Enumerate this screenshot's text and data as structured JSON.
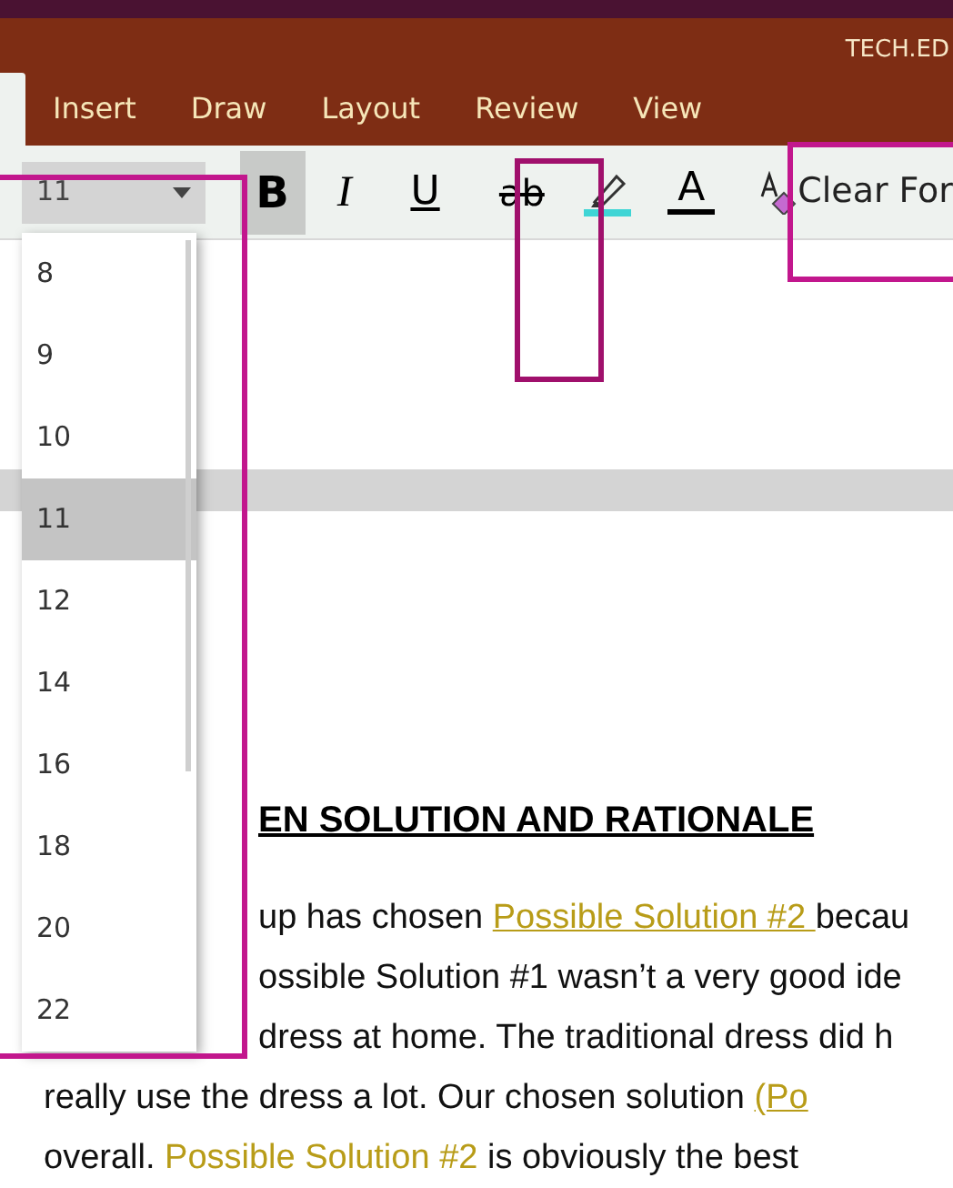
{
  "title_bar": {
    "title": "TECH.ED"
  },
  "tabs": [
    {
      "label": "Insert",
      "selected": false
    },
    {
      "label": "Draw",
      "selected": false
    },
    {
      "label": "Layout",
      "selected": false
    },
    {
      "label": "Review",
      "selected": false
    },
    {
      "label": "View",
      "selected": false
    }
  ],
  "toolbar": {
    "font_size": "11",
    "buttons": [
      {
        "kind": "bold",
        "label": "B",
        "pressed": true
      },
      {
        "kind": "italic",
        "label": "I",
        "pressed": false
      },
      {
        "kind": "underline",
        "label": "U",
        "pressed": false
      },
      {
        "kind": "strikethrough",
        "label": "ab",
        "pressed": false
      },
      {
        "kind": "highlight",
        "pressed": false
      },
      {
        "kind": "font_color",
        "label": "A",
        "pressed": false
      },
      {
        "kind": "clear",
        "label": "Clear For",
        "pressed": false
      }
    ]
  },
  "size_dropdown": {
    "items": [
      {
        "label": "8",
        "selected": false
      },
      {
        "label": "9",
        "selected": false
      },
      {
        "label": "10",
        "selected": false
      },
      {
        "label": "11",
        "selected": true
      },
      {
        "label": "12",
        "selected": false
      },
      {
        "label": "14",
        "selected": false
      },
      {
        "label": "16",
        "selected": false
      },
      {
        "label": "18",
        "selected": false
      },
      {
        "label": "20",
        "selected": false
      },
      {
        "label": "22",
        "selected": false
      }
    ]
  },
  "document": {
    "heading": "EN SOLUTION AND RATIONALE",
    "lines": [
      [
        {
          "kind": "plain",
          "text": "up has chosen "
        },
        {
          "kind": "link",
          "text": "Possible Solution #2 "
        },
        {
          "kind": "plain",
          "text": "becau"
        }
      ],
      [
        {
          "kind": "plain",
          "text": "ossible Solution #1 wasn’t a very good ide"
        }
      ],
      [
        {
          "kind": "plain",
          "text": "dress at home. The traditional dress did h"
        }
      ],
      [
        {
          "kind": "plain",
          "text": "really use the dress a lot. Our chosen solution "
        },
        {
          "kind": "link",
          "text": "(Po"
        }
      ],
      [
        {
          "kind": "plain",
          "text": "overall. "
        },
        {
          "kind": "colored",
          "text": "Possible Solution #2"
        },
        {
          "kind": "plain",
          "text": " is obviously the best"
        }
      ]
    ]
  }
}
